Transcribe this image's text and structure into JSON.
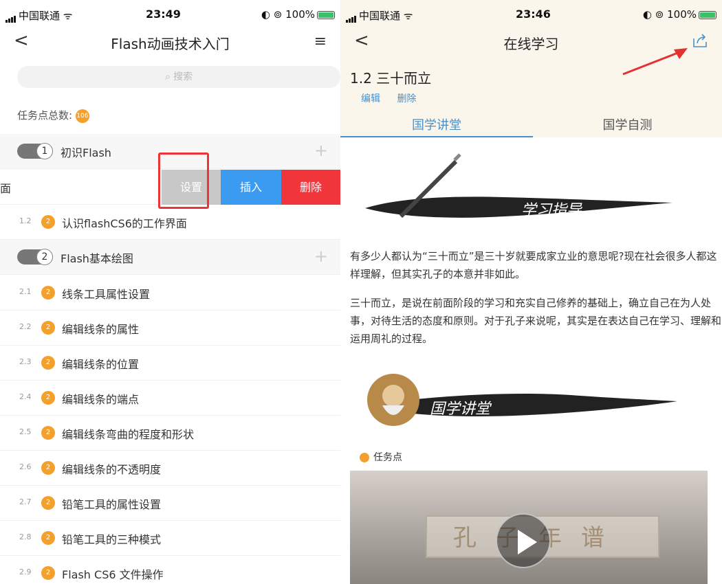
{
  "left": {
    "status": {
      "carrier": "中国联通",
      "time": "23:49",
      "battery": "100%"
    },
    "nav": {
      "back": "<",
      "title": "Flash动画技术入门",
      "menu": "≡"
    },
    "search_placeholder": "搜索",
    "task_total_label": "任务点总数:",
    "task_total_value": "106",
    "chapters": [
      {
        "num": "1",
        "title": "初识Flash"
      },
      {
        "num": "2",
        "title": "Flash基本绘图"
      }
    ],
    "swiped_row": {
      "partial_text": "面",
      "actions": [
        "设置",
        "插入",
        "删除"
      ]
    },
    "items": [
      {
        "num": "1.2",
        "badge": "2",
        "title": "认识flashCS6的工作界面"
      },
      {
        "num": "2.1",
        "badge": "2",
        "title": "线条工具属性设置"
      },
      {
        "num": "2.2",
        "badge": "2",
        "title": "编辑线条的属性"
      },
      {
        "num": "2.3",
        "badge": "2",
        "title": "编辑线条的位置"
      },
      {
        "num": "2.4",
        "badge": "2",
        "title": "编辑线条的端点"
      },
      {
        "num": "2.5",
        "badge": "2",
        "title": "编辑线条弯曲的程度和形状"
      },
      {
        "num": "2.6",
        "badge": "2",
        "title": "编辑线条的不透明度"
      },
      {
        "num": "2.7",
        "badge": "2",
        "title": "铅笔工具的属性设置"
      },
      {
        "num": "2.8",
        "badge": "2",
        "title": "铅笔工具的三种模式"
      },
      {
        "num": "2.9",
        "badge": "2",
        "title": "Flash CS6 文件操作"
      }
    ]
  },
  "right": {
    "status": {
      "carrier": "中国联通",
      "time": "23:46",
      "battery": "100%"
    },
    "nav": {
      "back": "<",
      "title": "在线学习"
    },
    "lesson_title": "1.2 三十而立",
    "edit_label": "编辑",
    "delete_label": "删除",
    "tabs": [
      "国学讲堂",
      "国学自测"
    ],
    "banner1_text": "学习指导",
    "para1": "有多少人都认为“三十而立”是三十岁就要成家立业的意思呢?现在社会很多人都这样理解，但其实孔子的本意并非如此。",
    "para2": "三十而立，是说在前面阶段的学习和充实自己修养的基础上，确立自己在为人处事，对待生活的态度和原则。对于孔子来说呢，其实是在表达自己在学习、理解和运用周礼的过程。",
    "banner2_text": "国学讲堂",
    "task_point_label": "任务点",
    "video_title": "孔子年谱"
  },
  "colors": {
    "accent_blue": "#4a90c8",
    "orange_badge": "#f4a02c",
    "swipe_gray": "#c8c8c8",
    "swipe_blue": "#3a9bf0",
    "swipe_red": "#f0353b",
    "highlight_red": "#ee3333"
  }
}
